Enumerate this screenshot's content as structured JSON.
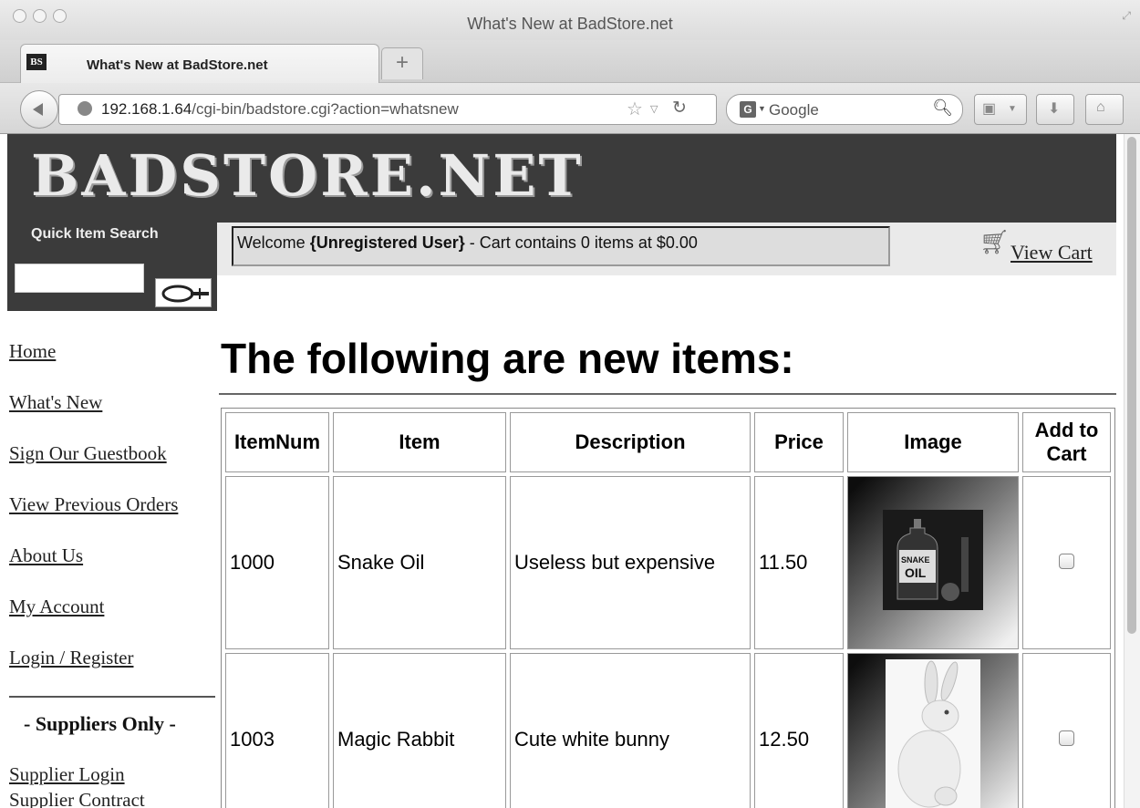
{
  "window": {
    "title": "What's New at BadStore.net",
    "tab_title": "What's New at BadStore.net",
    "tab_favicon_text": "BS",
    "new_tab_label": "+"
  },
  "toolbar": {
    "url_host": "192.168.1.64",
    "url_path": "/cgi-bin/badstore.cgi?action=whatsnew",
    "search_placeholder": "Google",
    "search_engine_icon": "G"
  },
  "site": {
    "logo": "BADSTORE.NET",
    "quick_search_label": "Quick Item Search",
    "welcome_prefix": "Welcome ",
    "welcome_user": "{Unregistered User}",
    "welcome_suffix": " - Cart contains 0 items at $0.00",
    "view_cart": "View Cart"
  },
  "nav": {
    "items": [
      "Home",
      "What's New",
      "Sign Our Guestbook",
      "View Previous Orders",
      "About Us",
      "My Account",
      "Login / Register"
    ],
    "suppliers_heading": "- Suppliers Only -",
    "supplier_items": [
      "Supplier Login",
      "Supplier Contract"
    ]
  },
  "main": {
    "heading": "The following are new items:",
    "columns": [
      "ItemNum",
      "Item",
      "Description",
      "Price",
      "Image",
      "Add to Cart"
    ],
    "rows": [
      {
        "itemnum": "1000",
        "item": "Snake Oil",
        "description": "Useless but expensive",
        "price": "11.50",
        "image": "snake-oil-bottle",
        "checked": false
      },
      {
        "itemnum": "1003",
        "item": "Magic Rabbit",
        "description": "Cute white bunny",
        "price": "12.50",
        "image": "white-rabbit",
        "checked": false
      }
    ]
  }
}
